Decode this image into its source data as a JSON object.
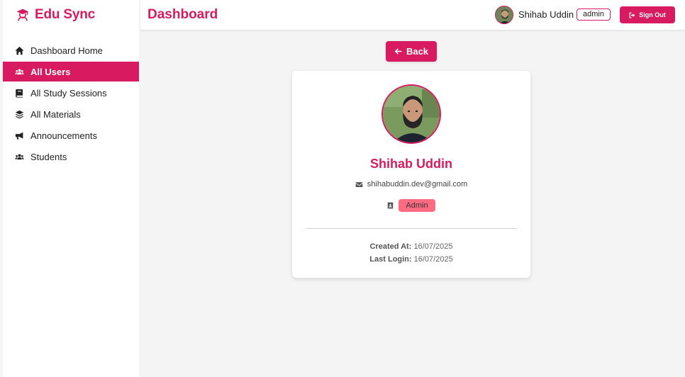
{
  "brand": {
    "name": "Edu Sync",
    "icon": "graduate-icon"
  },
  "header": {
    "title": "Dashboard"
  },
  "user": {
    "name": "Shihab Uddin",
    "role": "admin",
    "signout_label": "Sign Out"
  },
  "sidebar": {
    "items": [
      {
        "label": "Dashboard Home",
        "icon": "home-icon",
        "active": false
      },
      {
        "label": "All Users",
        "icon": "users-icon",
        "active": true
      },
      {
        "label": "All Study Sessions",
        "icon": "book-icon",
        "active": false
      },
      {
        "label": "All Materials",
        "icon": "layers-icon",
        "active": false
      },
      {
        "label": "Announcements",
        "icon": "megaphone-icon",
        "active": false
      },
      {
        "label": "Students",
        "icon": "users-icon",
        "active": false
      }
    ]
  },
  "main": {
    "back_label": "Back",
    "profile": {
      "name": "Shihab Uddin",
      "email": "shihabuddin.dev@gmail.com",
      "role": "Admin",
      "created_label": "Created At:",
      "created_value": "16/07/2025",
      "login_label": "Last Login:",
      "login_value": "16/07/2025"
    }
  },
  "colors": {
    "accent": "#d81b60",
    "role_pill": "#ff6b81",
    "background": "#f4f4f4"
  }
}
